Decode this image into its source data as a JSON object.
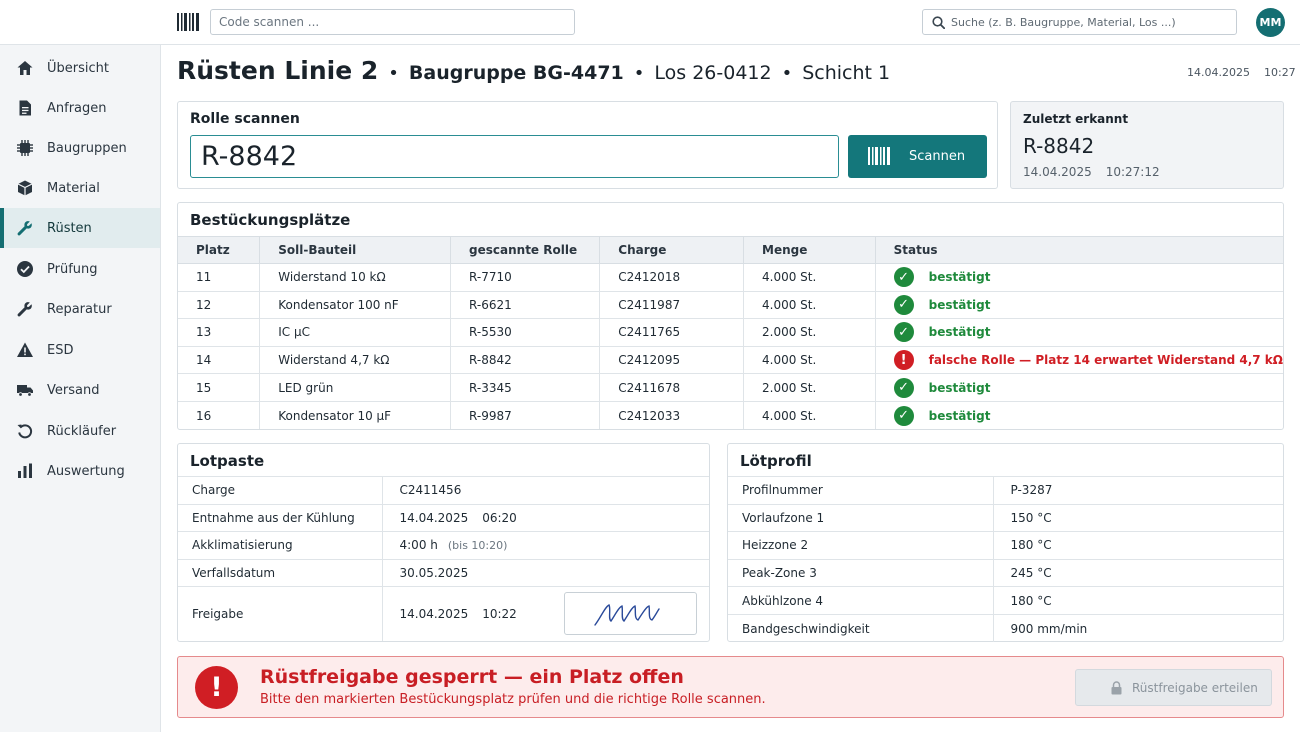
{
  "topbar": {
    "code_placeholder": "Code scannen ...",
    "search_placeholder": "Suche (z. B. Baugruppe, Material, Los ...)",
    "user_initials": "MM"
  },
  "sidebar": {
    "items": [
      {
        "label": "Übersicht",
        "icon": "home-icon"
      },
      {
        "label": "Anfragen",
        "icon": "document-icon"
      },
      {
        "label": "Baugruppen",
        "icon": "chip-icon"
      },
      {
        "label": "Material",
        "icon": "box-icon"
      },
      {
        "label": "Rüsten",
        "icon": "wrench-icon",
        "active": true
      },
      {
        "label": "Prüfung",
        "icon": "check-circle-icon"
      },
      {
        "label": "Reparatur",
        "icon": "wrench-icon"
      },
      {
        "label": "ESD",
        "icon": "warning-icon"
      },
      {
        "label": "Versand",
        "icon": "truck-icon"
      },
      {
        "label": "Rückläufer",
        "icon": "return-icon"
      },
      {
        "label": "Auswertung",
        "icon": "bar-chart-icon"
      }
    ]
  },
  "header": {
    "title": "Rüsten Linie 2",
    "assembly": "Baugruppe BG-4471",
    "lot": "Los 26-0412",
    "shift": "Schicht 1",
    "separator": "•",
    "date": "14.04.2025",
    "time": "10:27"
  },
  "scan": {
    "title": "Rolle scannen",
    "value": "R-8842",
    "button_label": "Scannen"
  },
  "last": {
    "title": "Zuletzt erkannt",
    "value": "R-8842",
    "date": "14.04.2025",
    "time": "10:27:12"
  },
  "slots": {
    "title": "Bestückungsplätze",
    "columns": [
      "Platz",
      "Soll-Bauteil",
      "gescannte Rolle",
      "Charge",
      "Menge",
      "Status"
    ],
    "rows": [
      {
        "platz": "11",
        "bauteil": "Widerstand 10 kΩ",
        "rolle": "R-7710",
        "charge": "C2412018",
        "menge": "4.000 St.",
        "status": "bestätigt",
        "ok": true
      },
      {
        "platz": "12",
        "bauteil": "Kondensator 100 nF",
        "rolle": "R-6621",
        "charge": "C2411987",
        "menge": "4.000 St.",
        "status": "bestätigt",
        "ok": true
      },
      {
        "platz": "13",
        "bauteil": "IC µC",
        "rolle": "R-5530",
        "charge": "C2411765",
        "menge": "2.000 St.",
        "status": "bestätigt",
        "ok": true
      },
      {
        "platz": "14",
        "bauteil": "Widerstand 4,7 kΩ",
        "rolle": "R-8842",
        "charge": "C2412095",
        "menge": "4.000 St.",
        "status": "falsche Rolle — Platz 14 erwartet Widerstand 4,7 kΩ",
        "ok": false
      },
      {
        "platz": "15",
        "bauteil": "LED grün",
        "rolle": "R-3345",
        "charge": "C2411678",
        "menge": "2.000 St.",
        "status": "bestätigt",
        "ok": true
      },
      {
        "platz": "16",
        "bauteil": "Kondensator 10 µF",
        "rolle": "R-9987",
        "charge": "C2412033",
        "menge": "4.000 St.",
        "status": "bestätigt",
        "ok": true
      }
    ]
  },
  "paste": {
    "title": "Lotpaste",
    "charge_label": "Charge",
    "charge_value": "C2411456",
    "removal_label": "Entnahme aus der Kühlung",
    "removal_date": "14.04.2025",
    "removal_time": "06:20",
    "acclim_label": "Akklimatisierung",
    "acclim_value": "4:00 h",
    "acclim_note": "(bis 10:20)",
    "expiry_label": "Verfallsdatum",
    "expiry_value": "30.05.2025",
    "release_label": "Freigabe",
    "release_date": "14.04.2025",
    "release_time": "10:22"
  },
  "profile": {
    "title": "Lötprofil",
    "rows": [
      {
        "label": "Profilnummer",
        "value": "P-3287"
      },
      {
        "label": "Vorlaufzone 1",
        "value": "150 °C"
      },
      {
        "label": "Heizzone 2",
        "value": "180 °C"
      },
      {
        "label": "Peak-Zone 3",
        "value": "245 °C"
      },
      {
        "label": "Abkühlzone 4",
        "value": "180 °C"
      },
      {
        "label": "Bandgeschwindigkeit",
        "value": "900 mm/min"
      }
    ]
  },
  "alert": {
    "title": "Rüstfreigabe gesperrt — ein Platz offen",
    "text": "Bitte den markierten Bestückungsplatz prüfen und die richtige Rolle scannen.",
    "icon_glyph": "!",
    "button_label": "Rüstfreigabe erteilen"
  },
  "colors": {
    "accent": "#146e72",
    "ok": "#1f8a3c",
    "error": "#d01e24"
  }
}
